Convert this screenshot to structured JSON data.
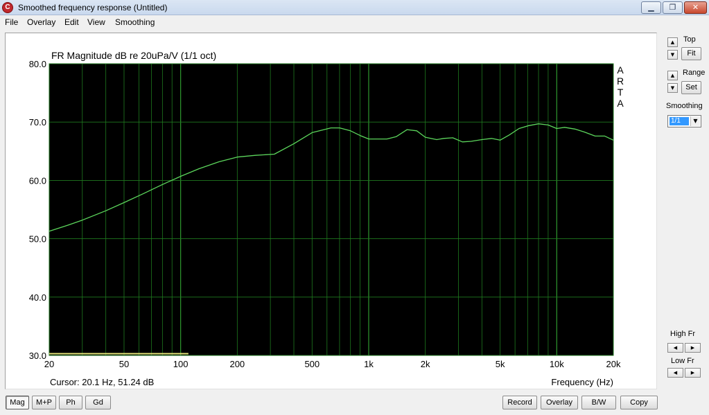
{
  "window": {
    "title": "Smoothed frequency response (Untitled)",
    "icon_glyph": "C",
    "min_glyph": "▁",
    "max_glyph": "❐",
    "close_glyph": "✕"
  },
  "menu": [
    "File",
    "Overlay",
    "Edit",
    "View",
    "Smoothing"
  ],
  "plot": {
    "title": "FR Magnitude dB re 20uPa/V (1/1 oct)",
    "watermark": [
      "A",
      "R",
      "T",
      "A"
    ],
    "cursor_text": "Cursor: 20.1 Hz, 51.24 dB",
    "xlabel": "Frequency (Hz)"
  },
  "chart_data": {
    "type": "line",
    "title": "FR Magnitude dB re 20uPa/V (1/1 oct)",
    "xlabel": "Frequency (Hz)",
    "ylabel": "",
    "xscale": "log",
    "xlim": [
      20,
      20000
    ],
    "ylim": [
      30,
      80
    ],
    "xticks": [
      {
        "value": 20,
        "label": "20"
      },
      {
        "value": 50,
        "label": "50"
      },
      {
        "value": 100,
        "label": "100"
      },
      {
        "value": 200,
        "label": "200"
      },
      {
        "value": 500,
        "label": "500"
      },
      {
        "value": 1000,
        "label": "1k"
      },
      {
        "value": 2000,
        "label": "2k"
      },
      {
        "value": 5000,
        "label": "5k"
      },
      {
        "value": 10000,
        "label": "10k"
      },
      {
        "value": 20000,
        "label": "20k"
      }
    ],
    "yticks": [
      {
        "value": 80,
        "label": "80.0"
      },
      {
        "value": 70,
        "label": "70.0"
      },
      {
        "value": 60,
        "label": "60.0"
      },
      {
        "value": 50,
        "label": "50.0"
      },
      {
        "value": 40,
        "label": "40.0"
      },
      {
        "value": 30,
        "label": "30.0"
      }
    ],
    "grid": true,
    "colors": {
      "background": "#000000",
      "grid": "#1f7a1f",
      "grid_major": "#2f9a2f",
      "curve": "#5cd65c",
      "marker": "#e6e67a"
    },
    "series": [
      {
        "x": [
          20,
          25,
          30,
          40,
          50,
          63,
          80,
          100,
          125,
          160,
          200,
          250,
          315,
          400,
          500,
          630,
          700,
          800,
          900,
          1000,
          1100,
          1250,
          1400,
          1600,
          1800,
          2000,
          2300,
          2500,
          2800,
          3150,
          3500,
          4000,
          4500,
          5000,
          5600,
          6300,
          7100,
          8000,
          9000,
          10000,
          11000,
          12500,
          14000,
          16000,
          18000,
          20000
        ],
        "y": [
          51.3,
          52.3,
          53.2,
          54.8,
          56.2,
          57.7,
          59.3,
          60.7,
          62.0,
          63.2,
          64.0,
          64.3,
          64.5,
          66.3,
          68.2,
          69.0,
          69.0,
          68.5,
          67.7,
          67.1,
          67.1,
          67.1,
          67.5,
          68.7,
          68.5,
          67.4,
          67.0,
          67.2,
          67.3,
          66.6,
          66.7,
          67.0,
          67.2,
          66.9,
          67.8,
          68.9,
          69.4,
          69.7,
          69.5,
          68.9,
          69.1,
          68.8,
          68.3,
          67.6,
          67.6,
          66.9
        ]
      }
    ],
    "range_marker": {
      "x": [
        20,
        110
      ],
      "y": 30.3
    }
  },
  "right_panel": {
    "top_label": "Top",
    "fit_label": "Fit",
    "range_label": "Range",
    "set_label": "Set",
    "smoothing_label": "Smoothing",
    "smoothing_value": "1/1",
    "high_fr_label": "High Fr",
    "low_fr_label": "Low Fr",
    "up_glyph": "▲",
    "down_glyph": "▼",
    "left_glyph": "◀",
    "right_glyph": "▶"
  },
  "bottom_buttons": {
    "mag": "Mag",
    "mp": "M+P",
    "ph": "Ph",
    "gd": "Gd",
    "record": "Record",
    "overlay": "Overlay",
    "bw": "B/W",
    "copy": "Copy"
  }
}
